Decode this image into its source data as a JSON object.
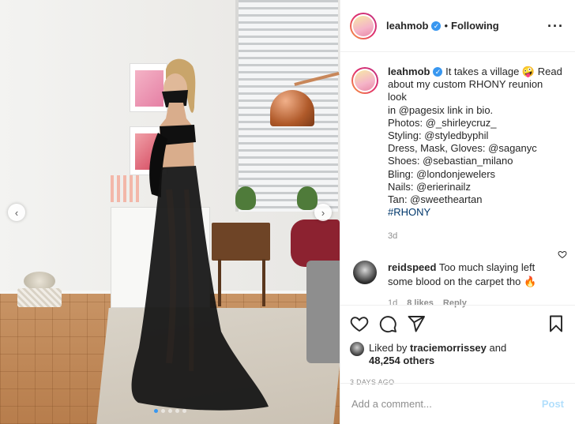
{
  "header": {
    "username": "leahmob",
    "separator": "•",
    "follow_status": "Following",
    "more_icon": "more-horizontal-icon",
    "verified_icon": "verified-badge-icon"
  },
  "caption": {
    "username": "leahmob",
    "lines": [
      "It takes a village 🤪 Read",
      "about my custom RHONY reunion look",
      "in @pagesix link in bio.",
      "Photos: @_shirleycruz_",
      "Styling: @styledbyphil",
      "Dress, Mask, Gloves: @saganyc",
      "Shoes: @sebastian_milano",
      "Bling: @londonjewelers",
      "Nails: @erierinailz",
      "Tan: @sweetheartan",
      "#RHONY"
    ],
    "age": "3d"
  },
  "comment": {
    "username": "reidspeed",
    "text_line1": "Too much slaying left",
    "text_line2": "some blood on the carpet tho 🔥",
    "age": "1d",
    "likes": "8 likes",
    "reply": "Reply"
  },
  "likes": {
    "prefix": "Liked by",
    "liker": "traciemorrissey",
    "and": "and",
    "others": "48,254 others"
  },
  "date": "3 DAYS AGO",
  "add_comment": {
    "placeholder": "Add a comment...",
    "post_label": "Post"
  },
  "carousel": {
    "prev": "‹",
    "next": "›",
    "dot_count": 5,
    "active_dot": 1
  },
  "colors": {
    "link": "#00376b",
    "verified": "#3897f0",
    "muted": "#8e8e8e",
    "post_disabled": "#b2dffc"
  }
}
